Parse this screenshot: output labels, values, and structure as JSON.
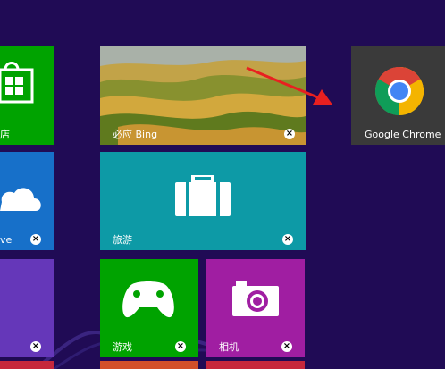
{
  "tiles": {
    "store": {
      "label": "店"
    },
    "skydrive": {
      "label": "ve"
    },
    "bing": {
      "label": "必应 Bing"
    },
    "chrome": {
      "label": "Google Chrome"
    },
    "travel": {
      "label": "旅游"
    },
    "games": {
      "label": "游戏"
    },
    "camera": {
      "label": "相机"
    }
  },
  "close_glyph": "×",
  "colors": {
    "background": "#200b55",
    "store": "#00a300",
    "skydrive": "#1770c9",
    "travel": "#0d9aa6",
    "games": "#00a300",
    "camera": "#a01ea2",
    "chrome_tile": "#3a3a3a",
    "annotation_arrow": "#e82020"
  },
  "annotation": {
    "type": "arrow",
    "points_to": "chrome-tile"
  }
}
